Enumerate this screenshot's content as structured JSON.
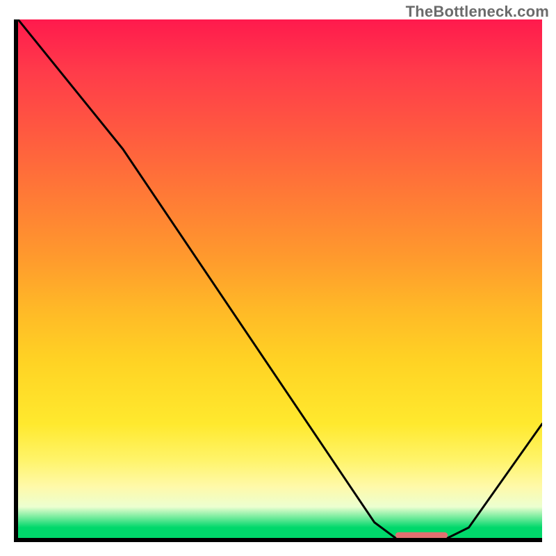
{
  "watermark": "TheBottleneck.com",
  "colors": {
    "gradient_top": "#ff1a4d",
    "gradient_mid": "#ffd324",
    "gradient_bottom": "#00d86b",
    "curve": "#000000",
    "marker": "#e07070",
    "axes": "#000000"
  },
  "chart_data": {
    "type": "line",
    "title": "",
    "xlabel": "",
    "ylabel": "",
    "xlim": [
      0,
      100
    ],
    "ylim": [
      0,
      100
    ],
    "grid": false,
    "legend": false,
    "curve": [
      {
        "x": 0,
        "y": 100
      },
      {
        "x": 20,
        "y": 75
      },
      {
        "x": 68,
        "y": 3
      },
      {
        "x": 72,
        "y": 0
      },
      {
        "x": 82,
        "y": 0
      },
      {
        "x": 86,
        "y": 2
      },
      {
        "x": 100,
        "y": 22
      }
    ],
    "marker_segment": {
      "x_start": 72,
      "x_end": 82,
      "y": 0.5,
      "thickness": 1.2
    },
    "background_heat_gradient": {
      "direction": "top_to_bottom",
      "stops": [
        {
          "pos": 0.0,
          "color": "#ff1a4d"
        },
        {
          "pos": 0.1,
          "color": "#ff3b4a"
        },
        {
          "pos": 0.22,
          "color": "#ff5a40"
        },
        {
          "pos": 0.34,
          "color": "#ff7a36"
        },
        {
          "pos": 0.46,
          "color": "#ff9a2d"
        },
        {
          "pos": 0.56,
          "color": "#ffb927"
        },
        {
          "pos": 0.66,
          "color": "#ffd324"
        },
        {
          "pos": 0.78,
          "color": "#ffe92e"
        },
        {
          "pos": 0.85,
          "color": "#fff46a"
        },
        {
          "pos": 0.9,
          "color": "#fff9a8"
        },
        {
          "pos": 0.94,
          "color": "#ecffd0"
        },
        {
          "pos": 0.98,
          "color": "#00d86b"
        },
        {
          "pos": 1.0,
          "color": "#00d86b"
        }
      ]
    }
  }
}
